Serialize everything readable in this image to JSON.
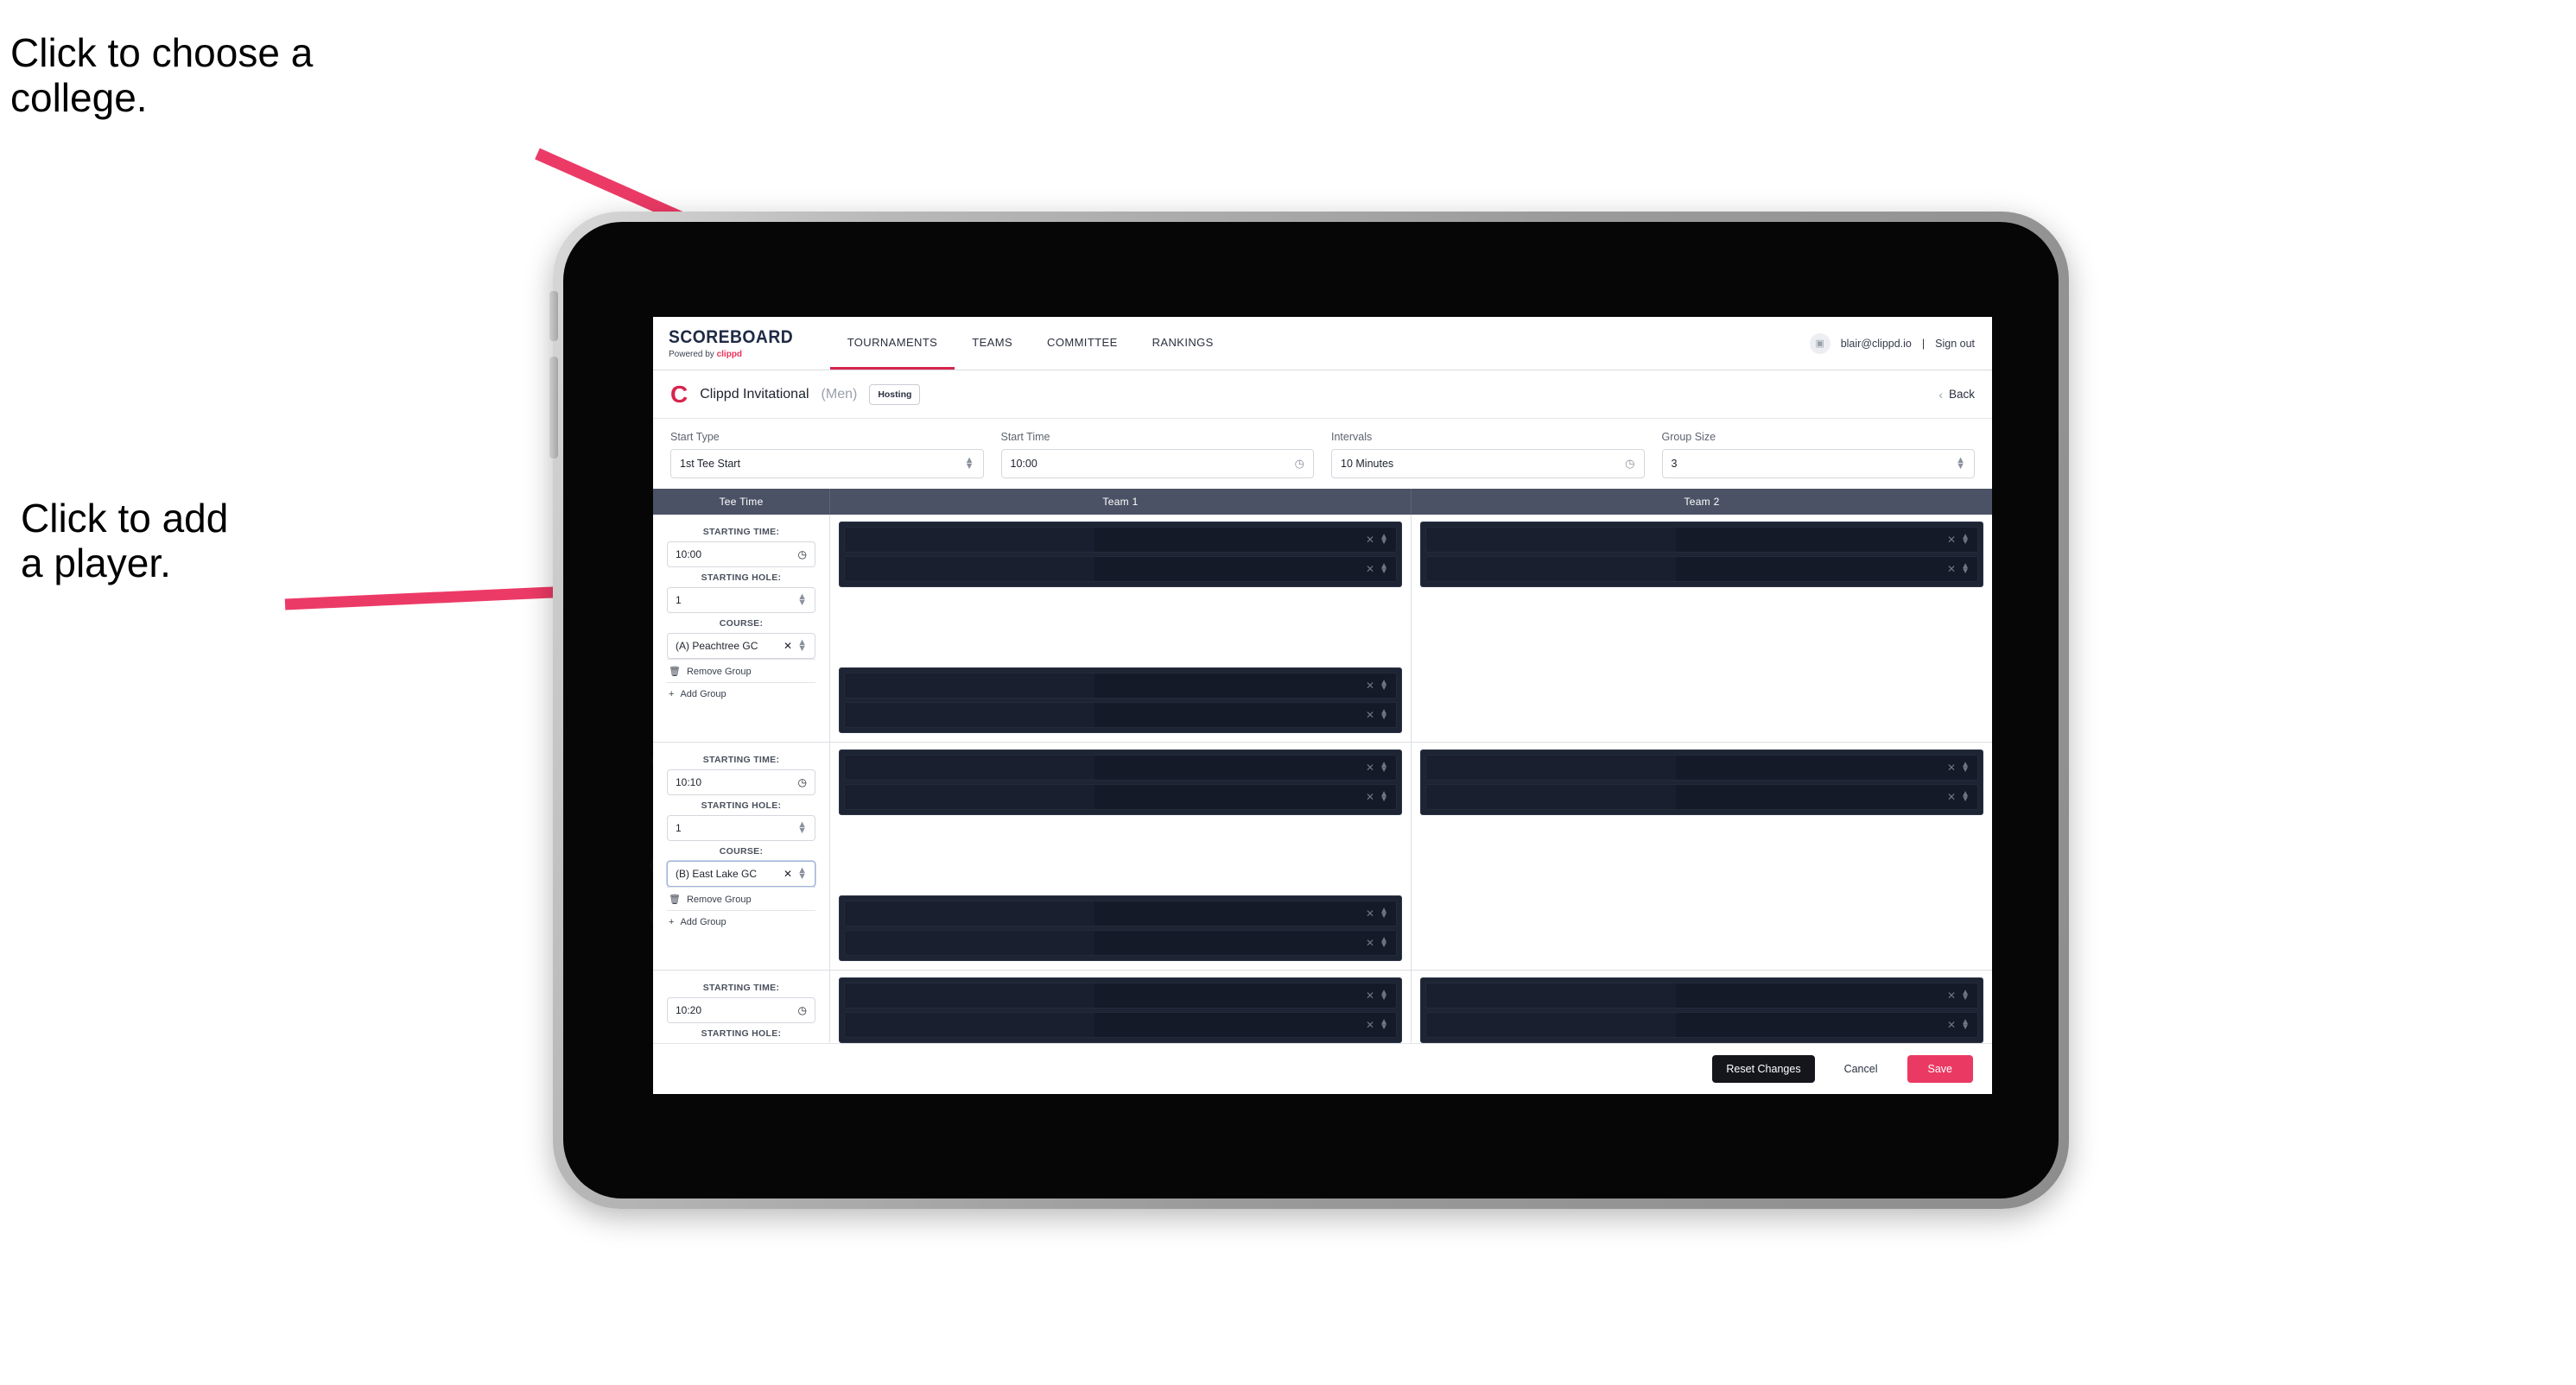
{
  "annotations": {
    "college": "Click to choose a\ncollege.",
    "player": "Click to add\na player.",
    "arrow_color": "#ec3a66"
  },
  "topnav": {
    "brand_word": "SCOREBOARD",
    "brand_sub_prefix": "Powered by ",
    "brand_sub_name": "clippd",
    "links": [
      {
        "label": "TOURNAMENTS",
        "active": true
      },
      {
        "label": "TEAMS",
        "active": false
      },
      {
        "label": "COMMITTEE",
        "active": false
      },
      {
        "label": "RANKINGS",
        "active": false
      }
    ],
    "avatar_icon": "user-avatar-icon",
    "account_email": "blair@clippd.io",
    "separator": "|",
    "sign_out": "Sign out"
  },
  "tournament_header": {
    "logo_letter": "C",
    "title": "Clippd Invitational",
    "gender": "(Men)",
    "badge": "Hosting",
    "back_chevron": "‹",
    "back_label": "Back"
  },
  "controls": [
    {
      "label": "Start Type",
      "value": "1st Tee Start",
      "icon": "stepper-icon"
    },
    {
      "label": "Start Time",
      "value": "10:00",
      "icon": "clock-icon"
    },
    {
      "label": "Intervals",
      "value": "10 Minutes",
      "icon": "clock-icon"
    },
    {
      "label": "Group Size",
      "value": "3",
      "icon": "stepper-icon"
    }
  ],
  "table": {
    "headers": [
      "Tee Time",
      "Team 1",
      "Team 2"
    ],
    "labels": {
      "starting_time": "STARTING TIME:",
      "starting_hole": "STARTING HOLE:",
      "course": "COURSE:",
      "remove_group": "Remove Group",
      "add_group": "Add Group",
      "remove_icon": "trash-icon",
      "add_icon": "plus-icon",
      "clear_icon": "clear-x-icon",
      "stepper_icon": "stepper-icon",
      "clock_icon": "clock-icon"
    },
    "rows": [
      {
        "starting_time": "10:00",
        "starting_hole": "1",
        "course": "(A) Peachtree GC",
        "course_focused": false,
        "team1_blocks": [
          2,
          2
        ],
        "team2_blocks": [
          2
        ]
      },
      {
        "starting_time": "10:10",
        "starting_hole": "1",
        "course": "(B) East Lake GC",
        "course_focused": true,
        "team1_blocks": [
          2,
          2
        ],
        "team2_blocks": [
          2
        ]
      },
      {
        "starting_time": "10:20",
        "starting_hole": "",
        "course": "",
        "course_focused": false,
        "team1_blocks": [
          2
        ],
        "team2_blocks": [
          2
        ]
      }
    ]
  },
  "footer": {
    "reset": "Reset Changes",
    "cancel": "Cancel",
    "save": "Save",
    "save_color": "#ea3a63"
  }
}
